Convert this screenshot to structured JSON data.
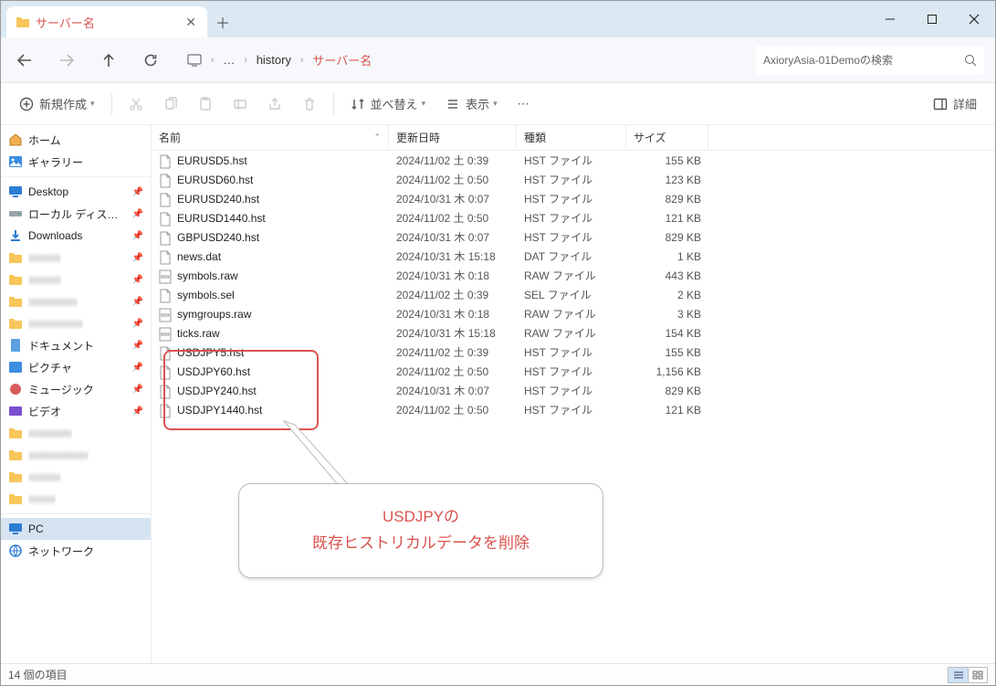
{
  "titlebar": {
    "tab_title": "サーバー名"
  },
  "breadcrumb": {
    "overflow": "…",
    "seg_history": "history",
    "seg_server": "サーバー名"
  },
  "search": {
    "placeholder": "AxioryAsia-01Demoの検索"
  },
  "toolbar": {
    "new": "新規作成",
    "sort": "並べ替え",
    "view": "表示",
    "details": "詳細"
  },
  "columns": {
    "name": "名前",
    "date": "更新日時",
    "type": "種類",
    "size": "サイズ"
  },
  "sidebar": {
    "home": "ホーム",
    "gallery": "ギャラリー",
    "desktop": "Desktop",
    "localdisk": "ローカル ディスク (C:)",
    "downloads": "Downloads",
    "documents": "ドキュメント",
    "pictures": "ピクチャ",
    "music": "ミュージック",
    "videos": "ビデオ",
    "pc": "PC",
    "network": "ネットワーク"
  },
  "files": [
    {
      "name": "EURUSD5.hst",
      "date": "2024/11/02 土 0:39",
      "type": "HST ファイル",
      "size": "155 KB",
      "icon": "file"
    },
    {
      "name": "EURUSD60.hst",
      "date": "2024/11/02 土 0:50",
      "type": "HST ファイル",
      "size": "123 KB",
      "icon": "file"
    },
    {
      "name": "EURUSD240.hst",
      "date": "2024/10/31 木 0:07",
      "type": "HST ファイル",
      "size": "829 KB",
      "icon": "file"
    },
    {
      "name": "EURUSD1440.hst",
      "date": "2024/11/02 土 0:50",
      "type": "HST ファイル",
      "size": "121 KB",
      "icon": "file"
    },
    {
      "name": "GBPUSD240.hst",
      "date": "2024/10/31 木 0:07",
      "type": "HST ファイル",
      "size": "829 KB",
      "icon": "file"
    },
    {
      "name": "news.dat",
      "date": "2024/10/31 木 15:18",
      "type": "DAT ファイル",
      "size": "1 KB",
      "icon": "file"
    },
    {
      "name": "symbols.raw",
      "date": "2024/10/31 木 0:18",
      "type": "RAW ファイル",
      "size": "443 KB",
      "icon": "raw"
    },
    {
      "name": "symbols.sel",
      "date": "2024/11/02 土 0:39",
      "type": "SEL ファイル",
      "size": "2 KB",
      "icon": "file"
    },
    {
      "name": "symgroups.raw",
      "date": "2024/10/31 木 0:18",
      "type": "RAW ファイル",
      "size": "3 KB",
      "icon": "raw"
    },
    {
      "name": "ticks.raw",
      "date": "2024/10/31 木 15:18",
      "type": "RAW ファイル",
      "size": "154 KB",
      "icon": "raw"
    },
    {
      "name": "USDJPY5.hst",
      "date": "2024/11/02 土 0:39",
      "type": "HST ファイル",
      "size": "155 KB",
      "icon": "file"
    },
    {
      "name": "USDJPY60.hst",
      "date": "2024/11/02 土 0:50",
      "type": "HST ファイル",
      "size": "1,156 KB",
      "icon": "file"
    },
    {
      "name": "USDJPY240.hst",
      "date": "2024/10/31 木 0:07",
      "type": "HST ファイル",
      "size": "829 KB",
      "icon": "file"
    },
    {
      "name": "USDJPY1440.hst",
      "date": "2024/11/02 土 0:50",
      "type": "HST ファイル",
      "size": "121 KB",
      "icon": "file"
    }
  ],
  "callout": {
    "line1": "USDJPYの",
    "line2": "既存ヒストリカルデータを削除"
  },
  "status": {
    "text": "14 個の項目"
  }
}
